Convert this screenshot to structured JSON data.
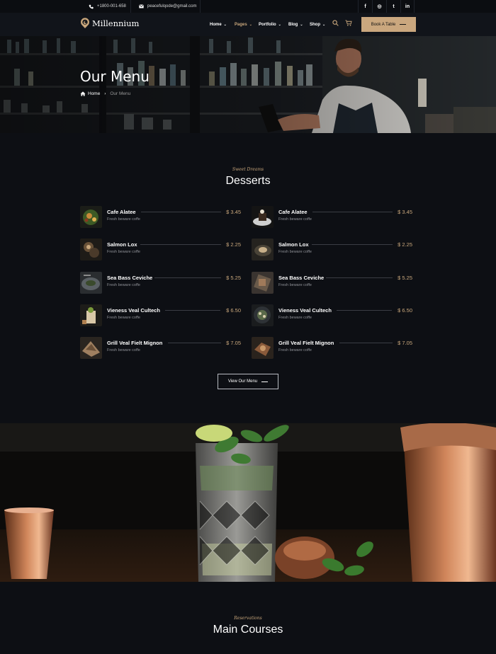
{
  "topbar": {
    "phone": "+1800-001-658",
    "email": "peacefulqode@gmail.com",
    "social": [
      "f",
      "◎",
      "t",
      "in"
    ]
  },
  "header": {
    "logo": "Millennium",
    "nav": [
      {
        "label": "Home"
      },
      {
        "label": "Pages"
      },
      {
        "label": "Portfolio"
      },
      {
        "label": "Blog"
      },
      {
        "label": "Shop"
      }
    ],
    "book_label": "Book A Table",
    "accent": "#c9a77c"
  },
  "hero": {
    "title": "Our Menu",
    "crumb_home": "Home",
    "crumb_current": "Our Menu"
  },
  "desserts": {
    "kicker": "Sweet Dreams",
    "title": "Desserts",
    "left": [
      {
        "name": "Cafe Alatee",
        "desc": "Fresh beware coffe",
        "price": "$ 3.45"
      },
      {
        "name": "Salmon Lox",
        "desc": "Fresh beware coffe",
        "price": "$ 2.25"
      },
      {
        "name": "Sea Bass Ceviche",
        "desc": "Fresh beware coffe",
        "price": "$ 5.25"
      },
      {
        "name": "Vieness Veal Cultech",
        "desc": "Fresh beware coffe",
        "price": "$ 6.50"
      },
      {
        "name": "Grill Veal Fielt Mignon",
        "desc": "Fresh beware coffe",
        "price": "$ 7.05"
      }
    ],
    "right": [
      {
        "name": "Cafe Alatee",
        "desc": "Fresh beware coffe",
        "price": "$ 3.45"
      },
      {
        "name": "Salmon Lox",
        "desc": "Fresh beware coffe",
        "price": "$ 2.25"
      },
      {
        "name": "Sea Bass Ceviche",
        "desc": "Fresh beware coffe",
        "price": "$ 5.25"
      },
      {
        "name": "Vieness Veal Cultech",
        "desc": "Fresh beware coffe",
        "price": "$ 6.50"
      },
      {
        "name": "Grill Veal Fielt Mignon",
        "desc": "Fresh beware coffe",
        "price": "$ 7.05"
      }
    ],
    "view_label": "View Our Menu"
  },
  "main_courses": {
    "kicker": "Reservations",
    "title": "Main Courses"
  }
}
